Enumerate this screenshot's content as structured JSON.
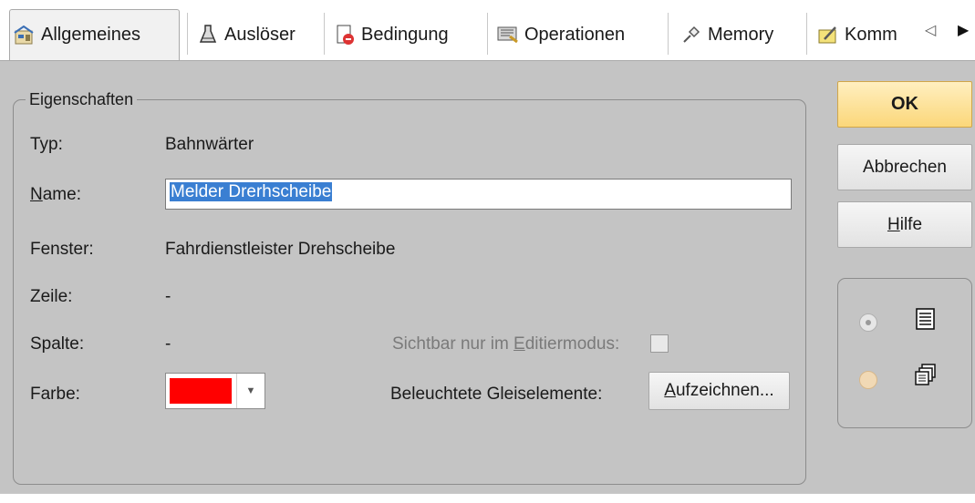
{
  "tabs": [
    {
      "label": "Allgemeines",
      "icon": "properties-icon",
      "active": true
    },
    {
      "label": "Auslöser",
      "icon": "flask-icon",
      "active": false
    },
    {
      "label": "Bedingung",
      "icon": "condition-icon",
      "active": false
    },
    {
      "label": "Operationen",
      "icon": "operations-icon",
      "active": false
    },
    {
      "label": "Memory",
      "icon": "pin-icon",
      "active": false
    },
    {
      "label": "Komm",
      "icon": "comment-icon",
      "active": false
    }
  ],
  "tab_scroll": {
    "left": "◁",
    "right": "▶"
  },
  "group": {
    "title": "Eigenschaften"
  },
  "fields": {
    "typ_label": "Typ:",
    "typ_value": "Bahnwärter",
    "name_label_underlined": "N",
    "name_label_rest": "ame:",
    "name_value": "Melder Drerhscheibe",
    "fenster_label": "Fenster:",
    "fenster_value": "Fahrdienstleister Drehscheibe",
    "zeile_label": "Zeile:",
    "zeile_value": "-",
    "spalte_label": "Spalte:",
    "spalte_value": "-",
    "sichtbar_label_a": "Sichtbar nur im ",
    "sichtbar_label_u": "E",
    "sichtbar_label_b": "ditiermodus:",
    "sichtbar_checked": false,
    "farbe_label": "Farbe:",
    "farbe_color": "#ff0000",
    "gleis_label": "Beleuchtete Gleiselemente:",
    "aufzeichnen_u": "A",
    "aufzeichnen_rest": "ufzeichnen..."
  },
  "buttons": {
    "ok": "OK",
    "abbrechen": "Abbrechen",
    "hilfe_u": "H",
    "hilfe_rest": "ilfe"
  },
  "view": {
    "options": [
      {
        "icon": "list-view-icon",
        "selected": true
      },
      {
        "icon": "multi-window-icon",
        "selected": false
      }
    ]
  },
  "colors": {
    "accent": "#fbd77a",
    "selection": "#3a7fd2",
    "panel": "#c4c4c4"
  }
}
